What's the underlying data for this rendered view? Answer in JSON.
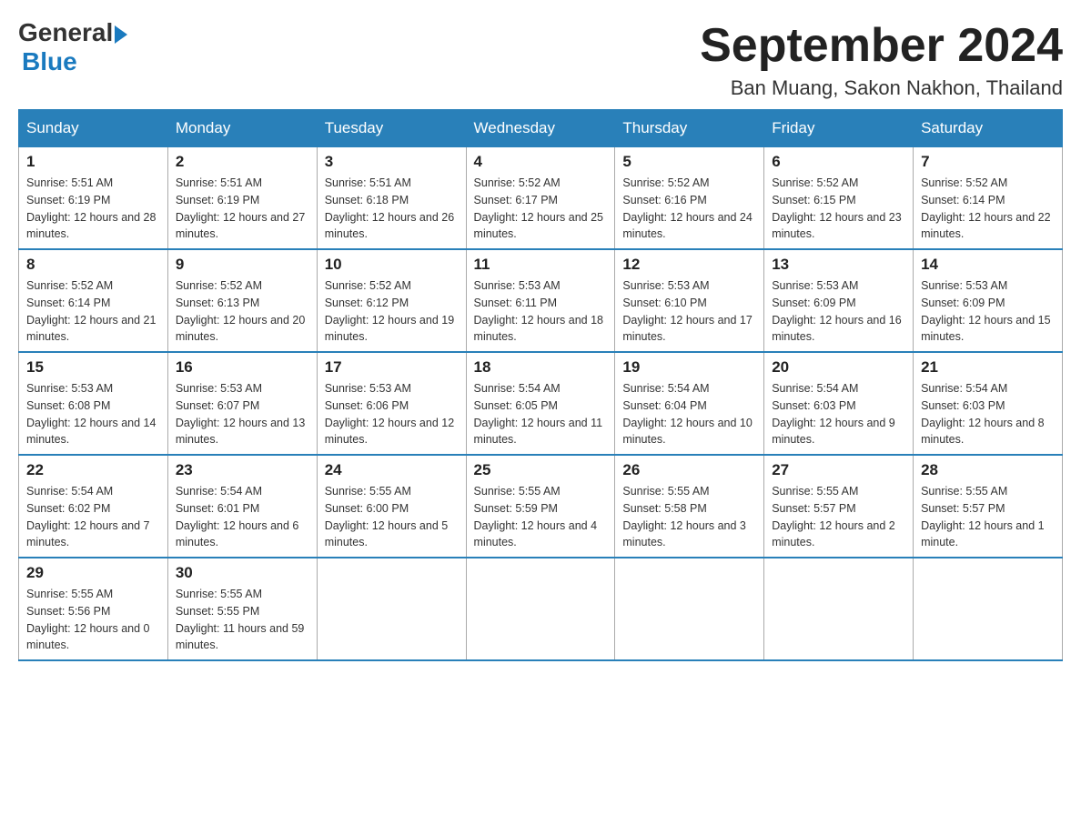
{
  "logo": {
    "general": "General",
    "blue": "Blue"
  },
  "title": "September 2024",
  "location": "Ban Muang, Sakon Nakhon, Thailand",
  "days_of_week": [
    "Sunday",
    "Monday",
    "Tuesday",
    "Wednesday",
    "Thursday",
    "Friday",
    "Saturday"
  ],
  "weeks": [
    [
      {
        "day": "1",
        "sunrise": "Sunrise: 5:51 AM",
        "sunset": "Sunset: 6:19 PM",
        "daylight": "Daylight: 12 hours and 28 minutes."
      },
      {
        "day": "2",
        "sunrise": "Sunrise: 5:51 AM",
        "sunset": "Sunset: 6:19 PM",
        "daylight": "Daylight: 12 hours and 27 minutes."
      },
      {
        "day": "3",
        "sunrise": "Sunrise: 5:51 AM",
        "sunset": "Sunset: 6:18 PM",
        "daylight": "Daylight: 12 hours and 26 minutes."
      },
      {
        "day": "4",
        "sunrise": "Sunrise: 5:52 AM",
        "sunset": "Sunset: 6:17 PM",
        "daylight": "Daylight: 12 hours and 25 minutes."
      },
      {
        "day": "5",
        "sunrise": "Sunrise: 5:52 AM",
        "sunset": "Sunset: 6:16 PM",
        "daylight": "Daylight: 12 hours and 24 minutes."
      },
      {
        "day": "6",
        "sunrise": "Sunrise: 5:52 AM",
        "sunset": "Sunset: 6:15 PM",
        "daylight": "Daylight: 12 hours and 23 minutes."
      },
      {
        "day": "7",
        "sunrise": "Sunrise: 5:52 AM",
        "sunset": "Sunset: 6:14 PM",
        "daylight": "Daylight: 12 hours and 22 minutes."
      }
    ],
    [
      {
        "day": "8",
        "sunrise": "Sunrise: 5:52 AM",
        "sunset": "Sunset: 6:14 PM",
        "daylight": "Daylight: 12 hours and 21 minutes."
      },
      {
        "day": "9",
        "sunrise": "Sunrise: 5:52 AM",
        "sunset": "Sunset: 6:13 PM",
        "daylight": "Daylight: 12 hours and 20 minutes."
      },
      {
        "day": "10",
        "sunrise": "Sunrise: 5:52 AM",
        "sunset": "Sunset: 6:12 PM",
        "daylight": "Daylight: 12 hours and 19 minutes."
      },
      {
        "day": "11",
        "sunrise": "Sunrise: 5:53 AM",
        "sunset": "Sunset: 6:11 PM",
        "daylight": "Daylight: 12 hours and 18 minutes."
      },
      {
        "day": "12",
        "sunrise": "Sunrise: 5:53 AM",
        "sunset": "Sunset: 6:10 PM",
        "daylight": "Daylight: 12 hours and 17 minutes."
      },
      {
        "day": "13",
        "sunrise": "Sunrise: 5:53 AM",
        "sunset": "Sunset: 6:09 PM",
        "daylight": "Daylight: 12 hours and 16 minutes."
      },
      {
        "day": "14",
        "sunrise": "Sunrise: 5:53 AM",
        "sunset": "Sunset: 6:09 PM",
        "daylight": "Daylight: 12 hours and 15 minutes."
      }
    ],
    [
      {
        "day": "15",
        "sunrise": "Sunrise: 5:53 AM",
        "sunset": "Sunset: 6:08 PM",
        "daylight": "Daylight: 12 hours and 14 minutes."
      },
      {
        "day": "16",
        "sunrise": "Sunrise: 5:53 AM",
        "sunset": "Sunset: 6:07 PM",
        "daylight": "Daylight: 12 hours and 13 minutes."
      },
      {
        "day": "17",
        "sunrise": "Sunrise: 5:53 AM",
        "sunset": "Sunset: 6:06 PM",
        "daylight": "Daylight: 12 hours and 12 minutes."
      },
      {
        "day": "18",
        "sunrise": "Sunrise: 5:54 AM",
        "sunset": "Sunset: 6:05 PM",
        "daylight": "Daylight: 12 hours and 11 minutes."
      },
      {
        "day": "19",
        "sunrise": "Sunrise: 5:54 AM",
        "sunset": "Sunset: 6:04 PM",
        "daylight": "Daylight: 12 hours and 10 minutes."
      },
      {
        "day": "20",
        "sunrise": "Sunrise: 5:54 AM",
        "sunset": "Sunset: 6:03 PM",
        "daylight": "Daylight: 12 hours and 9 minutes."
      },
      {
        "day": "21",
        "sunrise": "Sunrise: 5:54 AM",
        "sunset": "Sunset: 6:03 PM",
        "daylight": "Daylight: 12 hours and 8 minutes."
      }
    ],
    [
      {
        "day": "22",
        "sunrise": "Sunrise: 5:54 AM",
        "sunset": "Sunset: 6:02 PM",
        "daylight": "Daylight: 12 hours and 7 minutes."
      },
      {
        "day": "23",
        "sunrise": "Sunrise: 5:54 AM",
        "sunset": "Sunset: 6:01 PM",
        "daylight": "Daylight: 12 hours and 6 minutes."
      },
      {
        "day": "24",
        "sunrise": "Sunrise: 5:55 AM",
        "sunset": "Sunset: 6:00 PM",
        "daylight": "Daylight: 12 hours and 5 minutes."
      },
      {
        "day": "25",
        "sunrise": "Sunrise: 5:55 AM",
        "sunset": "Sunset: 5:59 PM",
        "daylight": "Daylight: 12 hours and 4 minutes."
      },
      {
        "day": "26",
        "sunrise": "Sunrise: 5:55 AM",
        "sunset": "Sunset: 5:58 PM",
        "daylight": "Daylight: 12 hours and 3 minutes."
      },
      {
        "day": "27",
        "sunrise": "Sunrise: 5:55 AM",
        "sunset": "Sunset: 5:57 PM",
        "daylight": "Daylight: 12 hours and 2 minutes."
      },
      {
        "day": "28",
        "sunrise": "Sunrise: 5:55 AM",
        "sunset": "Sunset: 5:57 PM",
        "daylight": "Daylight: 12 hours and 1 minute."
      }
    ],
    [
      {
        "day": "29",
        "sunrise": "Sunrise: 5:55 AM",
        "sunset": "Sunset: 5:56 PM",
        "daylight": "Daylight: 12 hours and 0 minutes."
      },
      {
        "day": "30",
        "sunrise": "Sunrise: 5:55 AM",
        "sunset": "Sunset: 5:55 PM",
        "daylight": "Daylight: 11 hours and 59 minutes."
      },
      null,
      null,
      null,
      null,
      null
    ]
  ]
}
